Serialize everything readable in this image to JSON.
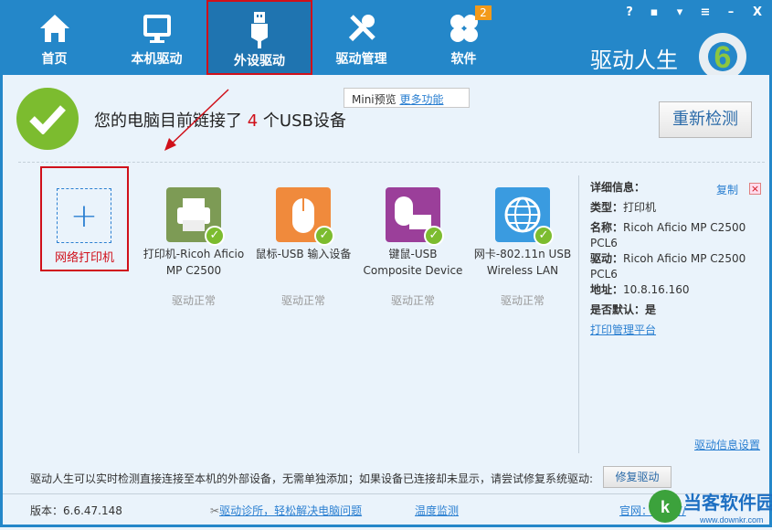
{
  "nav": [
    {
      "label": "首页",
      "icon": "home-icon"
    },
    {
      "label": "本机驱动",
      "icon": "monitor-icon"
    },
    {
      "label": "外设驱动",
      "icon": "usb-icon"
    },
    {
      "label": "驱动管理",
      "icon": "tools-icon"
    },
    {
      "label": "软件",
      "icon": "apps-icon",
      "badge": "2"
    }
  ],
  "brand": "驱动人生",
  "brand_logo_digit": "6",
  "window_controls": [
    "help-icon",
    "feedback-icon",
    "skin-icon",
    "menu-icon",
    "minimize-icon",
    "close-icon"
  ],
  "status": {
    "prefix": "您的电脑目前链接了",
    "count": "4",
    "suffix": "个USB设备"
  },
  "mini": {
    "label": "Mini预览",
    "more": "更多功能"
  },
  "recheck": "重新检测",
  "add_printer": "网络打印机",
  "devices": [
    {
      "name": "打印机-Ricoh Aficio MP C2500",
      "status": "驱动正常",
      "color": "#7d9b55"
    },
    {
      "name": "鼠标-USB 输入设备",
      "status": "驱动正常",
      "color": "#f08a3c"
    },
    {
      "name": "键鼠-USB Composite Device",
      "status": "驱动正常",
      "color": "#9b3f9a"
    },
    {
      "name": "网卡-802.11n USB Wireless LAN",
      "status": "驱动正常",
      "color": "#3a9be0"
    }
  ],
  "detail": {
    "title": "详细信息：",
    "copy": "复制",
    "close": "×",
    "type_label": "类型：",
    "type": "打印机",
    "name_label": "名称：",
    "name": "Ricoh Aficio MP C2500 PCL6",
    "driver_label": "驱动：",
    "driver": "Ricoh Aficio MP C2500 PCL6",
    "addr_label": "地址：",
    "addr": "10.8.16.160",
    "default_label": "是否默认：",
    "default": "是",
    "manage": "打印管理平台",
    "settings": "驱动信息设置"
  },
  "footer": {
    "note": "驱动人生可以实时检测直接连接至本机的外部设备，无需单独添加；如果设备已连接却未显示，请尝试修复系统驱动:",
    "fix": "修复驱动",
    "version": "版本：6.6.47.148",
    "diag": "驱动诊所，轻松解决电脑问题",
    "temp": "温度监测",
    "site": "官网：http://"
  },
  "watermark": {
    "text": "当客软件园",
    "url": "www.downkr.com"
  }
}
